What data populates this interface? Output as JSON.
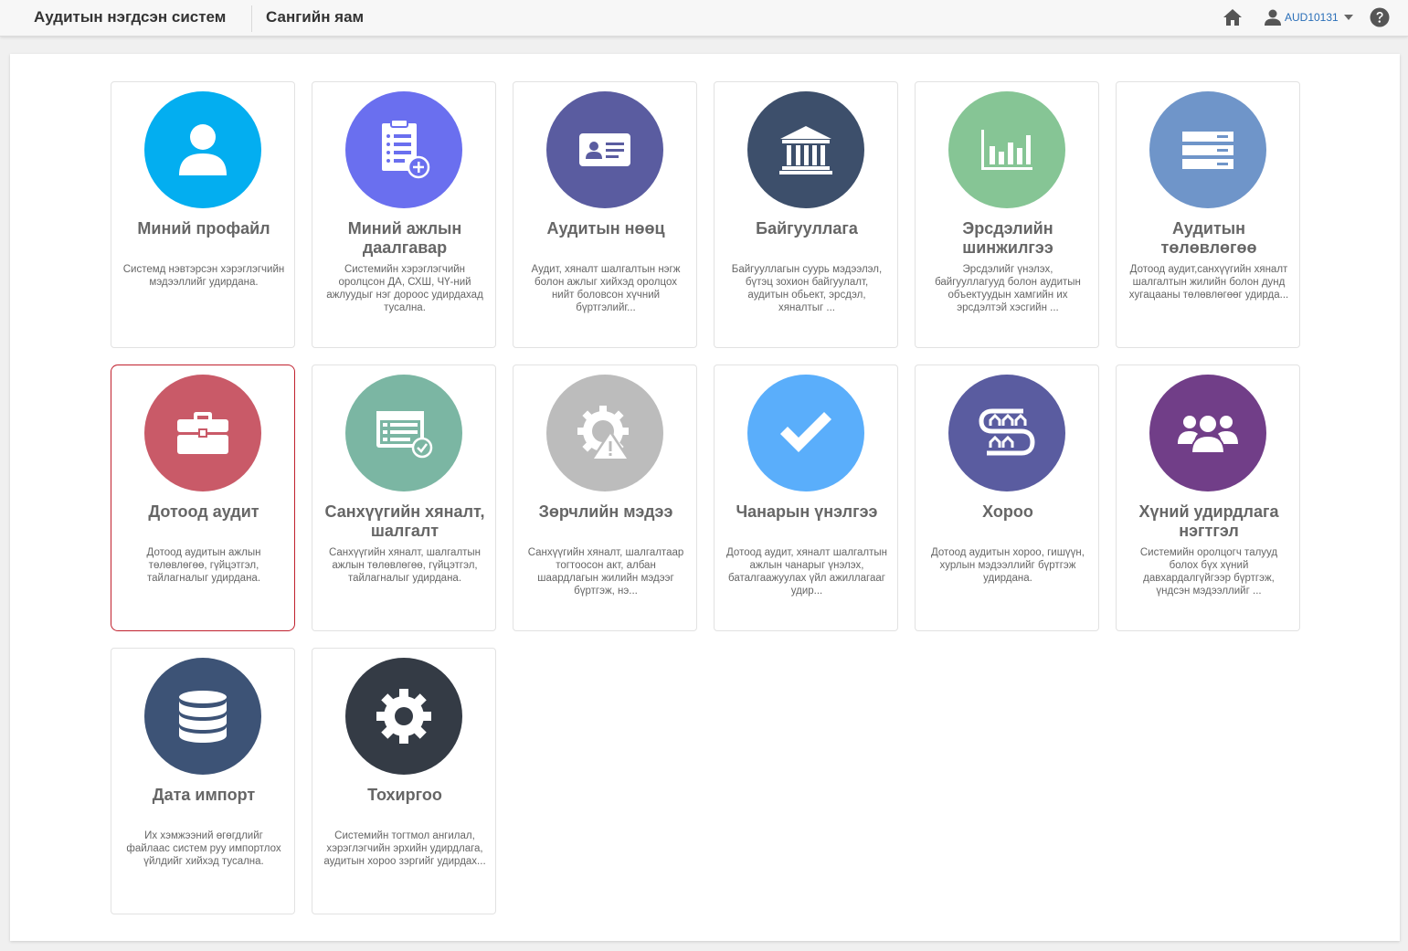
{
  "header": {
    "app_title": "Аудитын нэгдсэн систем",
    "org_title": "Сангийн яам",
    "username": "AUD10131"
  },
  "cards": [
    {
      "title": "Миний профайл",
      "description": "Системд нэвтэрсэн хэрэглэгчийн мэдээллийг удирдана.",
      "icon": "user-icon",
      "color": "#03aef0"
    },
    {
      "title": "Миний ажлын даалгавар",
      "description": "Системийн хэрэглэгчийн оролцсон ДА, СХШ, ЧҮ-ний ажлуудыг нэг дороос удирдахад тусална.",
      "icon": "clipboard-list-icon",
      "color": "#6a6fef"
    },
    {
      "title": "Аудитын нөөц",
      "description": "Аудит, хяналт шалгалтын нэгж болон ажлыг хийхэд оролцох нийт боловсон хүчний бүртгэлийг...",
      "icon": "id-card-icon",
      "color": "#5a5ca0"
    },
    {
      "title": "Байгууллага",
      "description": "Байгууллагын суурь мэдээлэл, бүтэц зохион байгуулалт, аудитын обьект, эрсдэл, хяналтыг ...",
      "icon": "bank-building-icon",
      "color": "#3d4f6b"
    },
    {
      "title": "Эрсдэлийн шинжилгээ",
      "description": "Эрсдэлийг үнэлэх, байгууллагууд болон аудитын объектуудын хамгийн их эрсдэлтэй хэсгийн ...",
      "icon": "bar-chart-icon",
      "color": "#86c595"
    },
    {
      "title": "Аудитын төлөвлөгөө",
      "description": "Дотоод аудит,санхүүгийн хяналт шалгалтын жилийн болон дунд хугацааны төлөвлөгөөг удирда...",
      "icon": "server-list-icon",
      "color": "#6f95c9"
    },
    {
      "title": "Дотоод аудит",
      "description": "Дотоод аудитын ажлын төлөвлөгөө, гүйцэтгэл, тайлагналыг удирдана.",
      "icon": "briefcase-icon",
      "color": "#c95a68"
    },
    {
      "title": "Санхүүгийн хяналт, шалгалт",
      "description": "Санхүүгийн хяналт, шалгалтын ажлын төлөвлөгөө, гүйцэтгэл, тайлагналыг удирдана.",
      "icon": "form-check-icon",
      "color": "#7bb6a3"
    },
    {
      "title": "Зөрчлийн мэдээ",
      "description": "Санхүүгийн хяналт, шалгалтаар тогтоосон акт, албан шаардлагын жилийн мэдээг бүртгэж, нэ...",
      "icon": "gear-warning-icon",
      "color": "#bcbcbc"
    },
    {
      "title": "Чанарын үнэлгээ",
      "description": "Дотоод аудит, хяналт шалгалтын ажлын чанарыг үнэлэх, баталгаажуулах үйл ажиллагааг удир...",
      "icon": "checkmark-icon",
      "color": "#5aaefb"
    },
    {
      "title": "Хороо",
      "description": "Дотоод аудитын хороо, гишүүн, хурлын мэдээллийг бүртгэж удирдана.",
      "icon": "committee-houses-icon",
      "color": "#5a5ca0"
    },
    {
      "title": "Хүний удирдлага нэгтгэл",
      "description": "Системийн оролцогч талууд болох бүх хүний давхардалгүйгээр бүртгэж, үндсэн мэдээллийг ...",
      "icon": "users-group-icon",
      "color": "#713e88"
    },
    {
      "title": "Дата импорт",
      "description": "Их хэмжээний өгөгдлийг файлаас систем руу импортлох үйлдийг хийхэд тусална.",
      "icon": "database-icon",
      "color": "#3d5376"
    },
    {
      "title": "Тохиргоо",
      "description": "Системийн тогтмол ангилал, хэрэглэгчийн эрхийн удирдлага, аудитын хороо зэргийг удирдах...",
      "icon": "settings-gear-icon",
      "color": "#343b45"
    }
  ]
}
